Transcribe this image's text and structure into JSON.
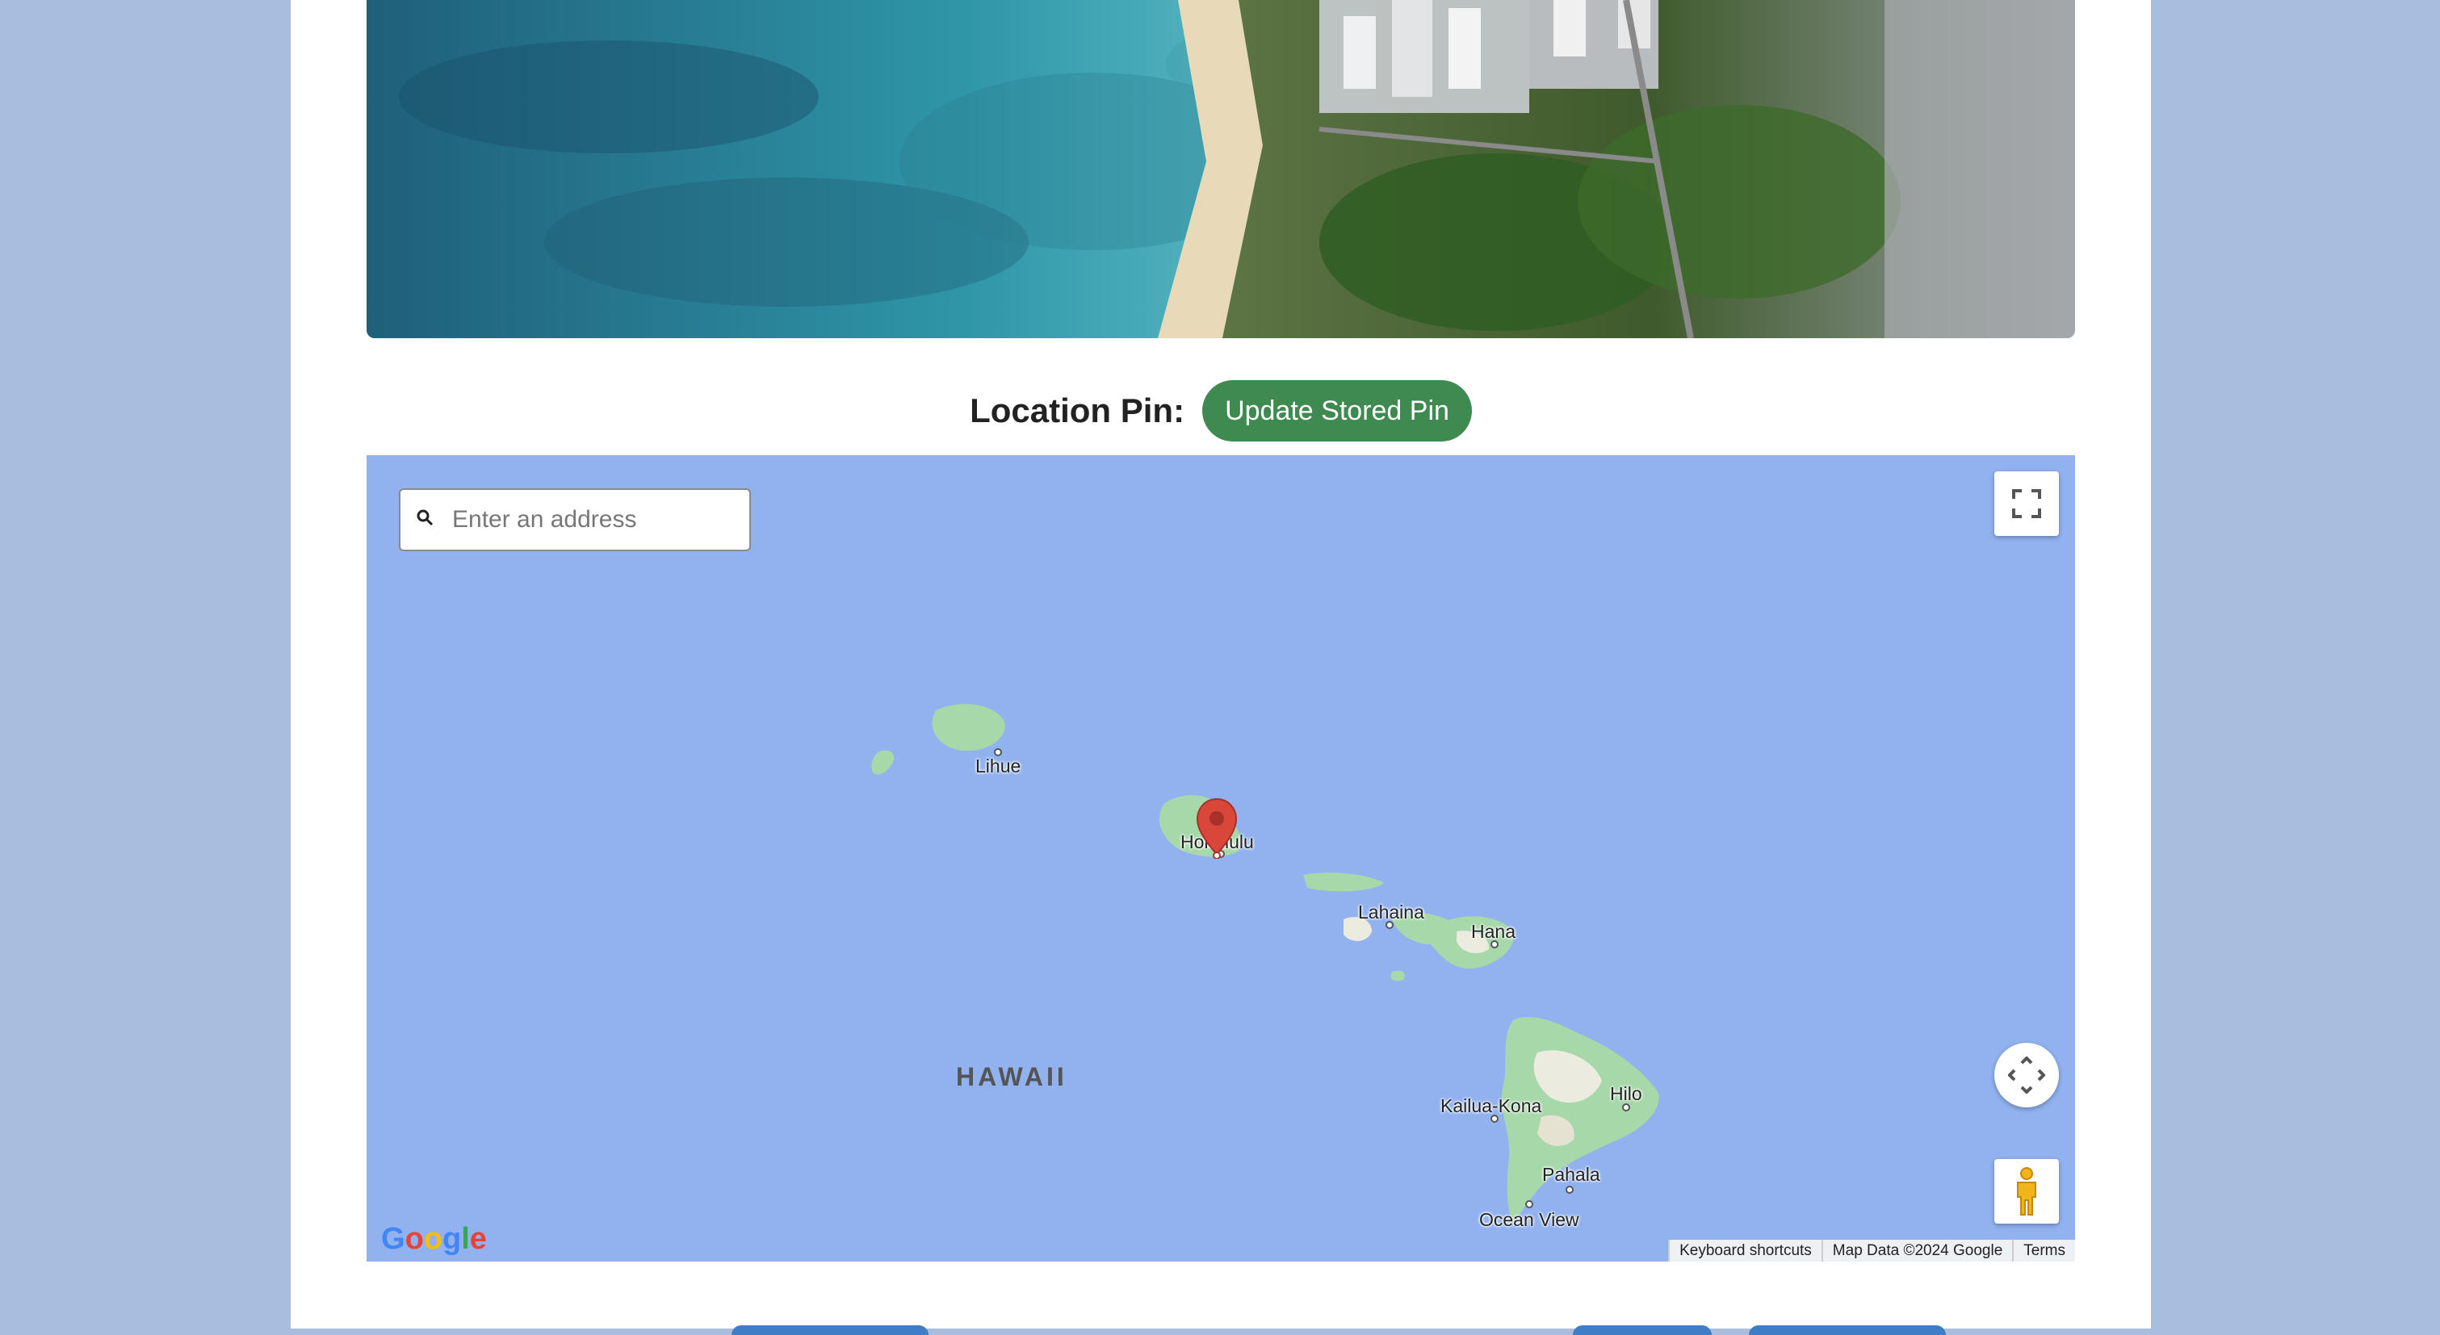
{
  "location_section": {
    "label": "Location Pin:",
    "update_button": "Update Stored Pin"
  },
  "map": {
    "search_placeholder": "Enter an address",
    "region_label": "HAWAII",
    "places": {
      "lihue": "Lihue",
      "honolulu": "Honolulu",
      "lahaina": "Lahaina",
      "hana": "Hana",
      "kailua_kona": "Kailua-Kona",
      "hilo": "Hilo",
      "pahala": "Pahala",
      "ocean_view": "Ocean View"
    },
    "logo": "Google",
    "attribution": {
      "shortcuts": "Keyboard shortcuts",
      "map_data": "Map Data ©2024 Google",
      "terms": "Terms"
    }
  },
  "icons": {
    "search": "search-icon",
    "fullscreen": "fullscreen-icon",
    "camera": "camera-control-icon",
    "pegman": "pegman-icon",
    "marker": "map-pin-icon"
  },
  "colors": {
    "page_background": "#a9bedf",
    "button_green": "#3f8a51",
    "map_water": "#91b2ef",
    "land": "#a7d8a9",
    "marker_red": "#d9473b"
  }
}
